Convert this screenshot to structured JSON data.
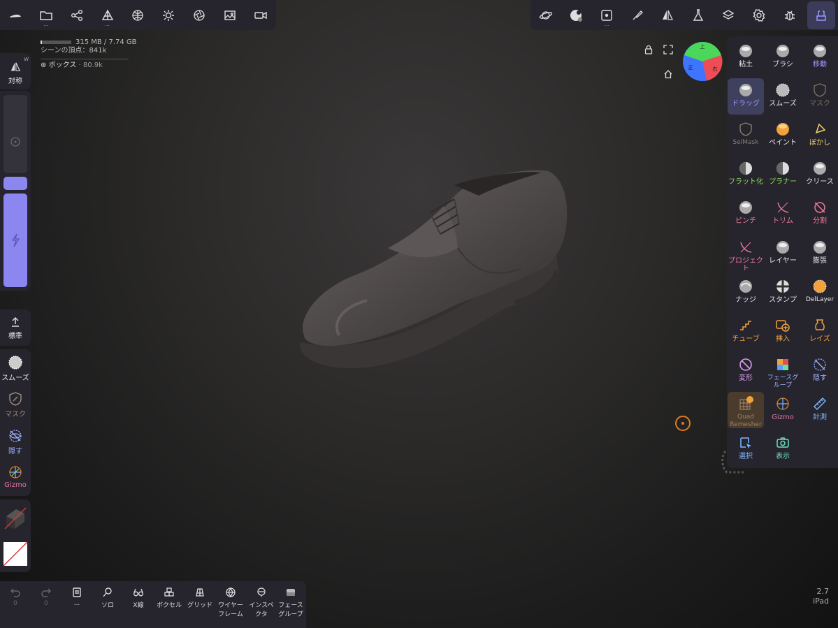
{
  "stats": {
    "memory": "315 MB / 7.74 GB",
    "vertices": "シーンの頂点：841k",
    "object_name": "ボックス",
    "object_count": "80.9k"
  },
  "left": {
    "symmetry": "対称",
    "symmetry_badge": "W",
    "standard": "標準",
    "smooth": "スムーズ",
    "mask": "マスク",
    "hide": "隠す",
    "gizmo": "Gizmo"
  },
  "brushes": [
    {
      "label": "粘土",
      "color": "#e6e6ec"
    },
    {
      "label": "ブラシ",
      "color": "#e6e6ec"
    },
    {
      "label": "移動",
      "color": "#9e98ff"
    },
    {
      "label": "ドラッグ",
      "color": "#9e98ff"
    },
    {
      "label": "スムーズ",
      "color": "#e6e6ec"
    },
    {
      "label": "マスク",
      "color": "#7b6f62"
    },
    {
      "label": "SelMask",
      "color": "#8a7c70"
    },
    {
      "label": "ペイント",
      "color": "#e6e6ec"
    },
    {
      "label": "ぼかし",
      "color": "#f3d46b"
    },
    {
      "label": "フラット化",
      "color": "#8fdc5a"
    },
    {
      "label": "プラナー",
      "color": "#8fdc5a"
    },
    {
      "label": "クリース",
      "color": "#e6e6ec"
    },
    {
      "label": "ピンチ",
      "color": "#f07a9a"
    },
    {
      "label": "トリム",
      "color": "#f07a9a"
    },
    {
      "label": "分割",
      "color": "#f07a9a"
    },
    {
      "label": "プロジェクト",
      "color": "#f07a9a"
    },
    {
      "label": "レイヤー",
      "color": "#e6e6ec"
    },
    {
      "label": "膨張",
      "color": "#e6e6ec"
    },
    {
      "label": "ナッジ",
      "color": "#e6e6ec"
    },
    {
      "label": "スタンプ",
      "color": "#e6e6ec"
    },
    {
      "label": "DelLayer",
      "color": "#e6e6ec"
    },
    {
      "label": "チューブ",
      "color": "#f2a23a"
    },
    {
      "label": "挿入",
      "color": "#f2a23a"
    },
    {
      "label": "レイズ",
      "color": "#f2a23a"
    },
    {
      "label": "変形",
      "color": "#d89cf0"
    },
    {
      "label": "フェースグループ",
      "color": "#9fb4ff"
    },
    {
      "label": "隠す",
      "color": "#9fb4ff"
    },
    {
      "label": "Quad Remesher",
      "color": "#9a8066"
    },
    {
      "label": "Gizmo",
      "color": "#e07a9a"
    },
    {
      "label": "計測",
      "color": "#7fb8ff"
    },
    {
      "label": "選択",
      "color": "#7fb8ff"
    },
    {
      "label": "表示",
      "color": "#6fe0c0"
    }
  ],
  "bottom": {
    "undo_count": "0",
    "redo_count": "0",
    "history_dots": "...",
    "solo": "ソロ",
    "xray": "X線",
    "voxel": "ボクセル",
    "grid": "グリッド",
    "wireframe": "ワイヤーフレーム",
    "inspector": "インスペクタ",
    "facegroup": "フェースグループ"
  },
  "viewcube": {
    "top": "上",
    "front": "正",
    "right": "右"
  },
  "version": {
    "number": "2.7",
    "device": "iPad"
  },
  "colors": {
    "accent": "#8c86f0",
    "panel": "#26252e",
    "orange": "#e07a1f"
  }
}
